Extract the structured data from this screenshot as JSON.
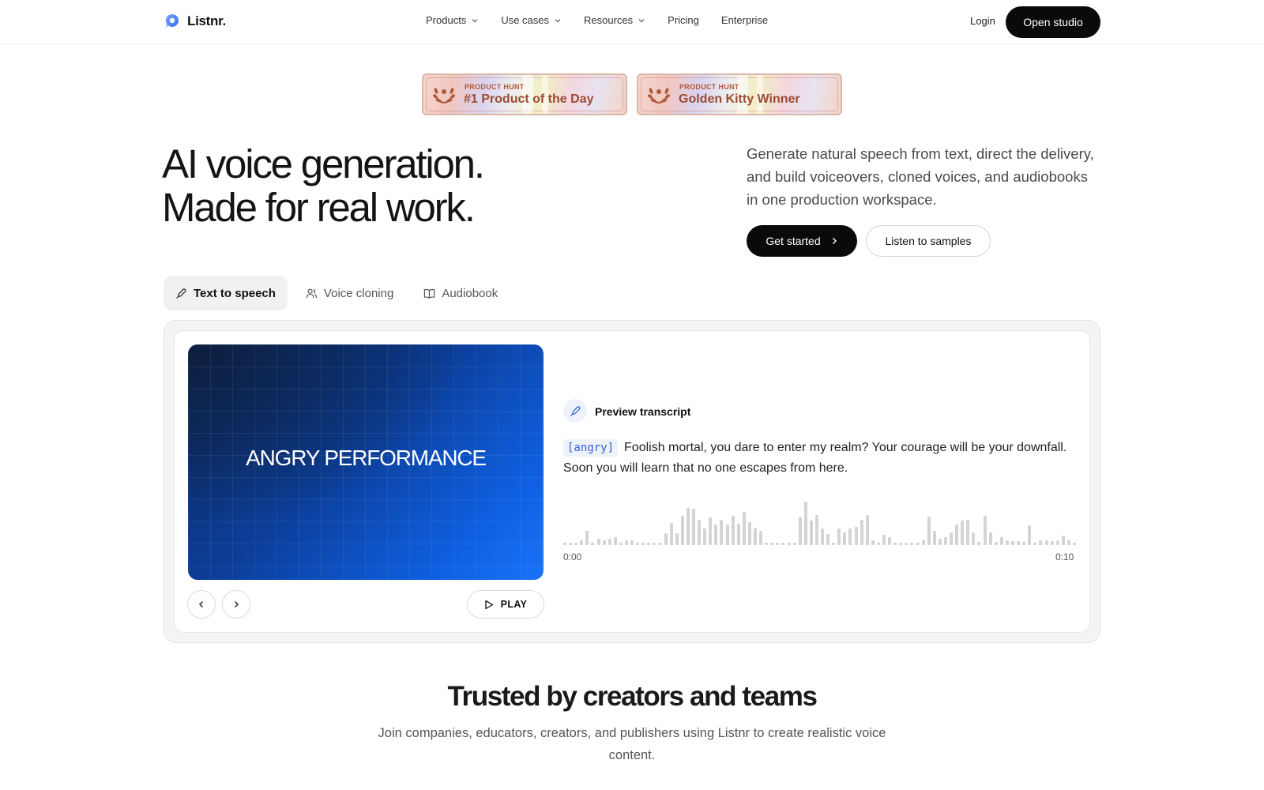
{
  "header": {
    "brand": "Listnr.",
    "nav": [
      {
        "label": "Products",
        "dropdown": true
      },
      {
        "label": "Use cases",
        "dropdown": true
      },
      {
        "label": "Resources",
        "dropdown": true
      },
      {
        "label": "Pricing",
        "dropdown": false
      },
      {
        "label": "Enterprise",
        "dropdown": false
      }
    ],
    "login": "Login",
    "cta": "Open studio"
  },
  "badges": [
    {
      "kicker": "PRODUCT HUNT",
      "title": "#1 Product of the Day"
    },
    {
      "kicker": "PRODUCT HUNT",
      "title": "Golden Kitty Winner"
    }
  ],
  "hero": {
    "title_line1": "AI voice generation.",
    "title_line2": "Made for real work.",
    "description": "Generate natural speech from text, direct the delivery, and build voiceovers, cloned voices, and audiobooks in one production workspace.",
    "primary_cta": "Get started",
    "secondary_cta": "Listen to samples"
  },
  "tabs": [
    {
      "label": "Text to speech",
      "icon": "pen-icon",
      "active": true
    },
    {
      "label": "Voice cloning",
      "icon": "users-icon",
      "active": false
    },
    {
      "label": "Audiobook",
      "icon": "book-icon",
      "active": false
    }
  ],
  "demo": {
    "video_label": "ANGRY PERFORMANCE",
    "play_label": "PLAY",
    "transcript_heading": "Preview transcript",
    "emotion_tag": "[angry]",
    "transcript": "Foolish mortal, you dare to enter my realm? Your courage will be your downfall. Soon you will learn that no one escapes from here.",
    "time_start": "0:00",
    "time_end": "0:10",
    "waveform_levels": [
      0.05,
      0.05,
      0.05,
      0.1,
      0.33,
      0.05,
      0.15,
      0.1,
      0.15,
      0.18,
      0.05,
      0.11,
      0.1,
      0.05,
      0.05,
      0.05,
      0.05,
      0.05,
      0.26,
      0.5,
      0.27,
      0.66,
      0.84,
      0.82,
      0.57,
      0.38,
      0.63,
      0.46,
      0.57,
      0.46,
      0.66,
      0.48,
      0.75,
      0.51,
      0.4,
      0.33,
      0.05,
      0.05,
      0.05,
      0.05,
      0.05,
      0.05,
      0.64,
      0.98,
      0.55,
      0.68,
      0.38,
      0.25,
      0.05,
      0.37,
      0.28,
      0.38,
      0.41,
      0.58,
      0.68,
      0.1,
      0.05,
      0.24,
      0.18,
      0.05,
      0.05,
      0.05,
      0.05,
      0.05,
      0.1,
      0.64,
      0.33,
      0.15,
      0.18,
      0.28,
      0.46,
      0.55,
      0.57,
      0.28,
      0.07,
      0.66,
      0.28,
      0.07,
      0.18,
      0.1,
      0.09,
      0.09,
      0.07,
      0.45,
      0.05,
      0.1,
      0.1,
      0.09,
      0.11,
      0.22,
      0.1,
      0.05
    ]
  },
  "trusted": {
    "title": "Trusted by creators and teams",
    "subtitle": "Join companies, educators, creators, and publishers using Listnr to create realistic voice content."
  },
  "colors": {
    "primary": "#0a0a0a",
    "accent_blue": "#2d5fd8",
    "video_gradient_end": "#1a73f7",
    "badge_text": "#9a4a34"
  }
}
